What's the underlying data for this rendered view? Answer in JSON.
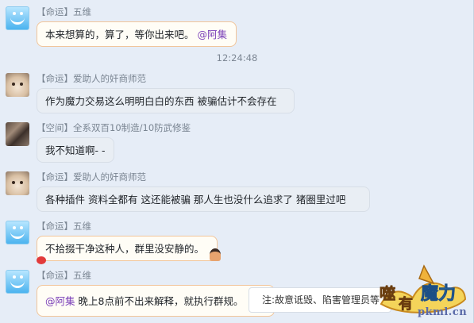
{
  "timestamp": "12:24:48",
  "messages": [
    {
      "sender": "【命运】五维",
      "text": "本来想算的，算了，等你出来吧。",
      "mention": "@阿集"
    },
    {
      "sender": "【命运】爱助人的奸商师范",
      "text": "作为魔力交易这么明明白白的东西  被骗估计不会存在"
    },
    {
      "sender": "【空间】全系双百10制造/10防武修鉴",
      "text": "我不知道啊- -"
    },
    {
      "sender": "【命运】爱助人的奸商师范",
      "text": "各种插件 资料全都有  这还能被骗  那人生也没什么追求了 猪圈里过吧"
    },
    {
      "sender": "【命运】五维",
      "text": "不拾掇干净这种人，群里没安静的。"
    },
    {
      "sender": "【命运】五维",
      "mention": "@阿集",
      "text": "晚上8点前不出来解释，就执行群规。"
    }
  ],
  "notice": {
    "text": "注:故意诋毁、陷害管理员等"
  },
  "watermark": {
    "logo_text": "噬有魔力",
    "domain": "pkml.cn"
  },
  "colors": {
    "mention": "#7a3fb8",
    "peach_border": "#f1c59a",
    "background": "#e6edf7"
  }
}
